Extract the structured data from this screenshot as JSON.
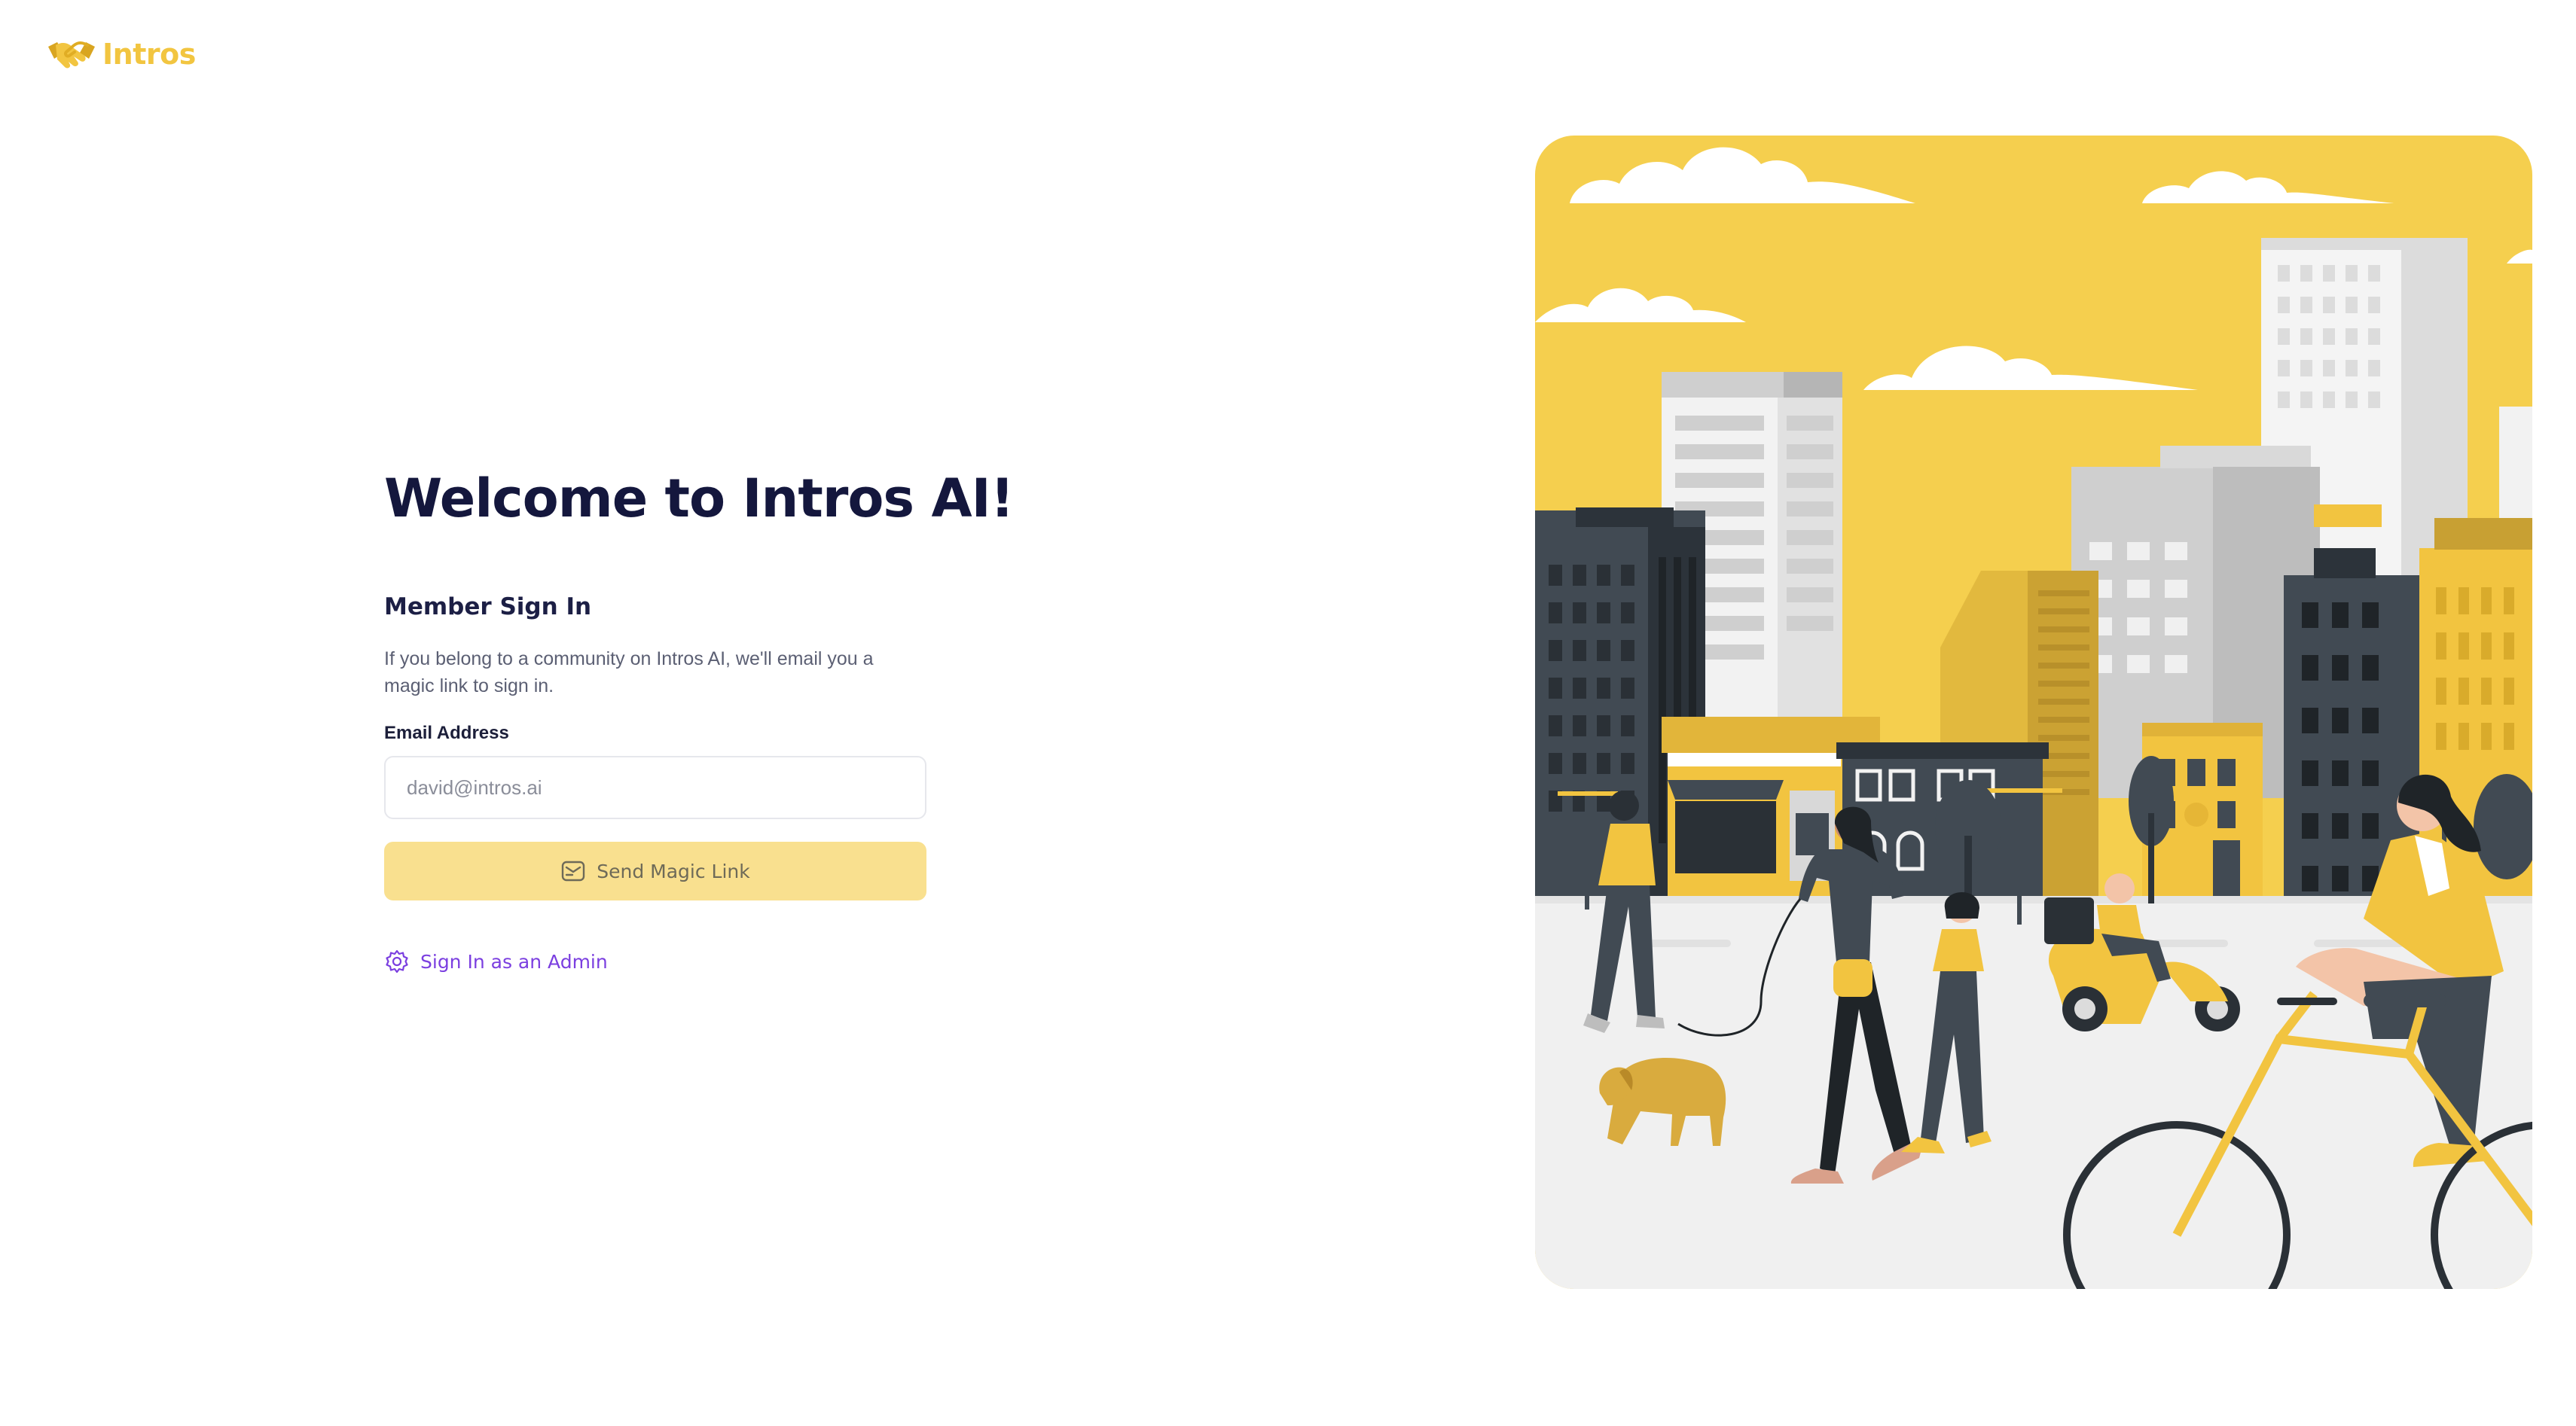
{
  "brand": {
    "name": "Intros",
    "logo_icon": "handshake-icon"
  },
  "login": {
    "title": "Welcome to Intros AI!",
    "subtitle": "Member Sign In",
    "description": "If you belong to a community on Intros AI, we'll email you a magic link to sign in.",
    "email_label": "Email Address",
    "email_placeholder": "david@intros.ai",
    "email_value": "",
    "submit_label": "Send Magic Link",
    "submit_icon": "mail-icon",
    "admin_link_label": "Sign In as an Admin",
    "admin_link_icon": "gear-icon"
  },
  "hero": {
    "illustration": "city-street-illustration"
  },
  "colors": {
    "brand_yellow": "#f2c540",
    "illustration_yellow": "#f5cf4e",
    "button_disabled": "#f9e08f",
    "title_navy": "#14173d",
    "link_purple": "#7b3fe0"
  }
}
